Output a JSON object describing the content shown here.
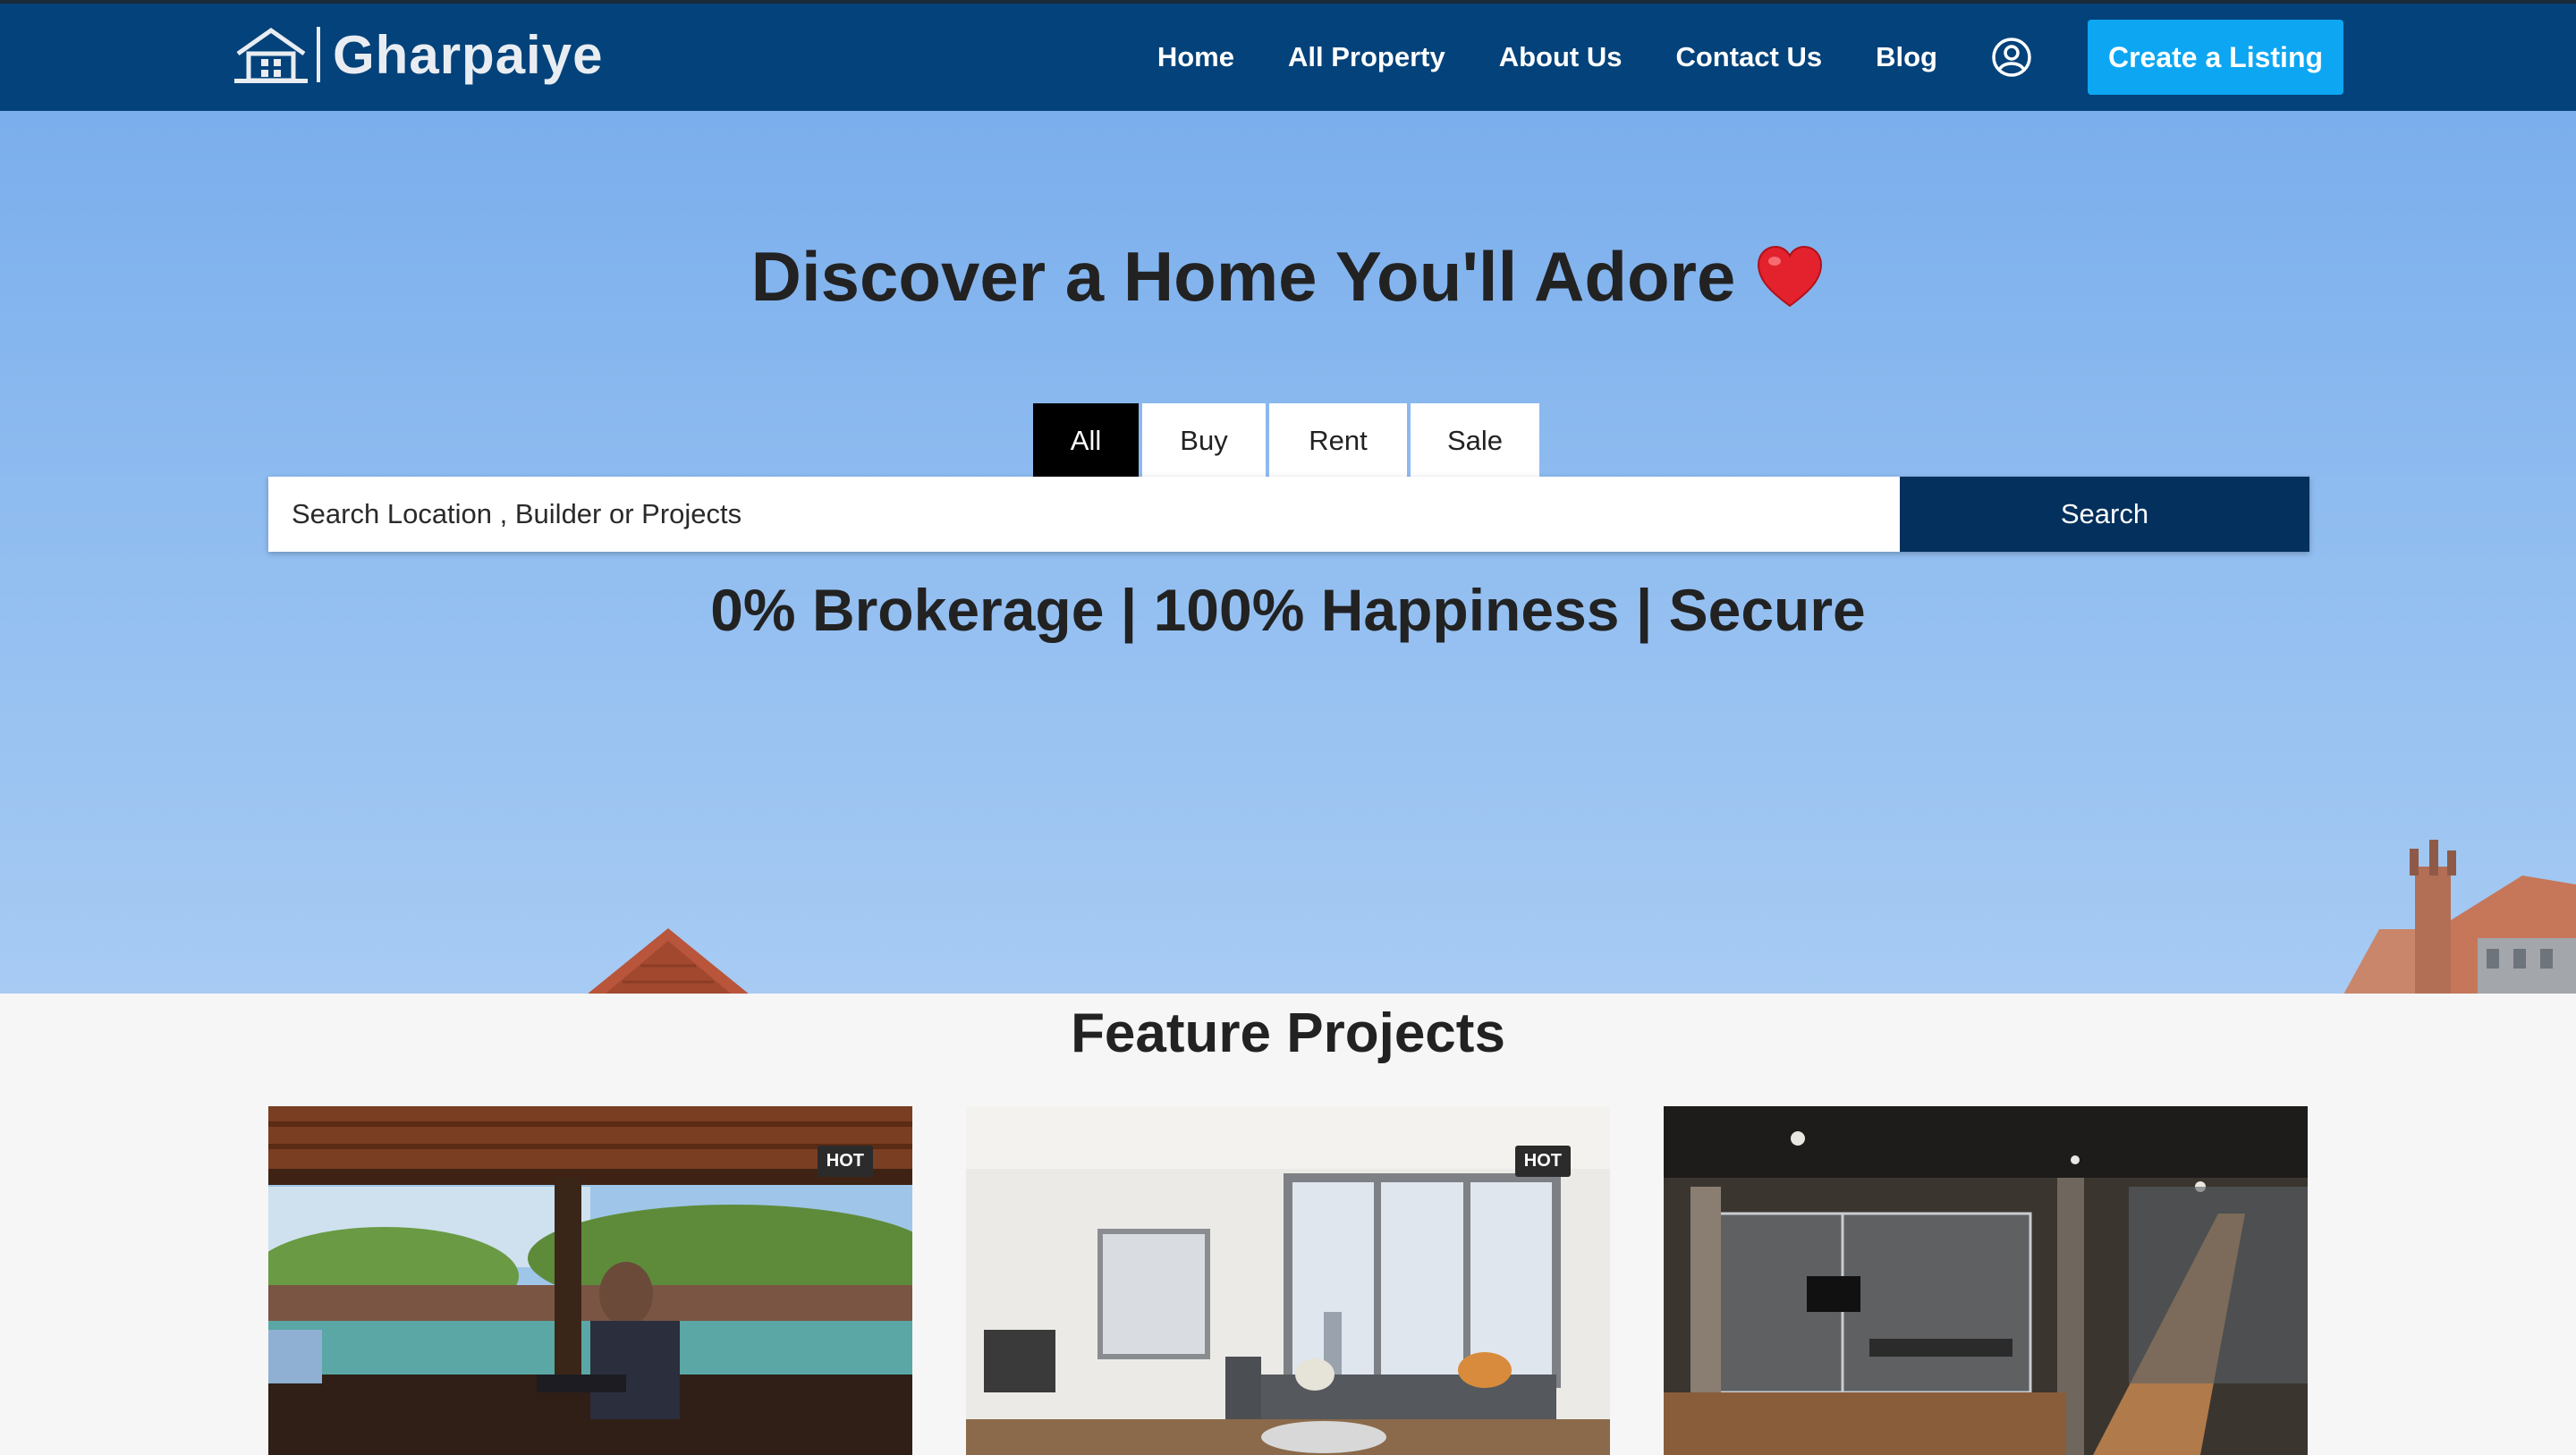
{
  "navbar": {
    "brand_name": "Gharpaiye",
    "links": [
      "Home",
      "All Property",
      "About Us",
      "Contact Us",
      "Blog"
    ],
    "create_listing_label": "Create a Listing"
  },
  "hero": {
    "title": "Discover a Home You'll Adore",
    "tabs": [
      "All",
      "Buy",
      "Rent",
      "Sale"
    ],
    "active_tab": "All",
    "search_placeholder": "Search Location , Builder or Projects",
    "search_value": "",
    "search_button_label": "Search",
    "tagline": "0% Brokerage | 100% Happiness | Secure"
  },
  "features": {
    "title": "Feature Projects",
    "cards": [
      {
        "badge": "HOT",
        "image": "person-working-by-pool"
      },
      {
        "badge": "HOT",
        "image": "bright-living-room"
      },
      {
        "badge": "",
        "image": "glass-office-meeting-rooms"
      }
    ]
  },
  "colors": {
    "navbar_bg": "#03427a",
    "accent_button": "#0da6f2",
    "search_button": "#03305d",
    "hero_sky": "#8fbcf0"
  }
}
